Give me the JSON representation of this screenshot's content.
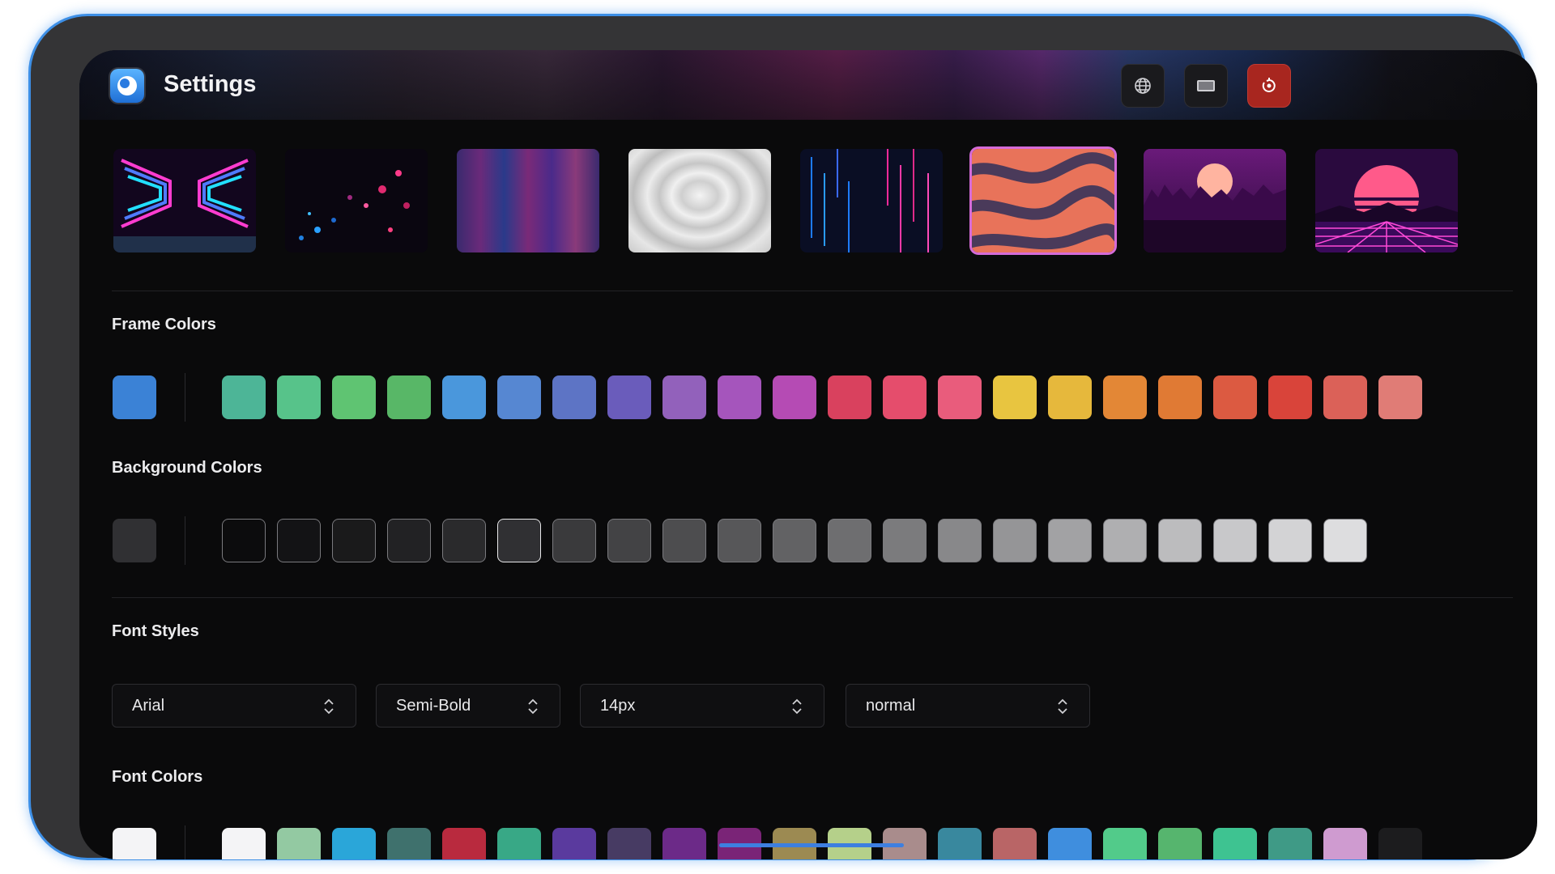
{
  "header": {
    "title": "Settings",
    "icons": [
      "globe-icon",
      "display-icon",
      "reset-icon"
    ],
    "reset_color": "#a8261f"
  },
  "wallpapers": {
    "items": [
      "neon-wings",
      "bokeh-particles",
      "purple-light-streaks",
      "white-ripples",
      "neon-rain-lines",
      "orange-liquid-waves",
      "synthwave-city",
      "synthwave-sun-grid"
    ],
    "selected_index": 5
  },
  "frame_colors": {
    "label": "Frame Colors",
    "current": "#3b82d6",
    "swatches": [
      "#4db597",
      "#57c38a",
      "#5fc472",
      "#58b767",
      "#4a97dc",
      "#5687d2",
      "#5d74c5",
      "#6a5cbb",
      "#9261bb",
      "#a555bc",
      "#b54bb4",
      "#d9415e",
      "#e54d6c",
      "#e95c7c",
      "#e8c540",
      "#e6b83c",
      "#e38736",
      "#e07a34",
      "#dc5a41",
      "#d9443a",
      "#db6158",
      "#e07c76"
    ]
  },
  "background_colors": {
    "label": "Background Colors",
    "current": "#303033",
    "swatches": [
      "#0c0c0d",
      "#131315",
      "#1a1a1b",
      "#222224",
      "#2a2a2c",
      "#303033",
      "#3a3a3c",
      "#434345",
      "#4d4d4f",
      "#575759",
      "#626264",
      "#6e6e70",
      "#7b7b7d",
      "#88888a",
      "#959597",
      "#a2a2a4",
      "#afafb1",
      "#bcbcbe",
      "#c8c8ca",
      "#d3d3d5",
      "#dddddf"
    ],
    "selected_index": 5
  },
  "font_styles": {
    "label": "Font Styles",
    "family": "Arial",
    "weight": "Semi-Bold",
    "size": "14px",
    "style": "normal"
  },
  "font_colors": {
    "label": "Font Colors",
    "current": "#f4f4f6",
    "swatches": [
      "#f4f4f6",
      "#93c9a2",
      "#2aa6d9",
      "#3f716d",
      "#b92a3e",
      "#38a886",
      "#5a3a9e",
      "#473b63",
      "#6c2a88",
      "#7a2477",
      "#9c8a52",
      "#b5d08a",
      "#a98c8c",
      "#39889e",
      "#b96566",
      "#3f8ede",
      "#52cb8a",
      "#56b56e",
      "#3ec391",
      "#3f9a86",
      "#cf9bd0",
      "#1c1c1e"
    ]
  }
}
